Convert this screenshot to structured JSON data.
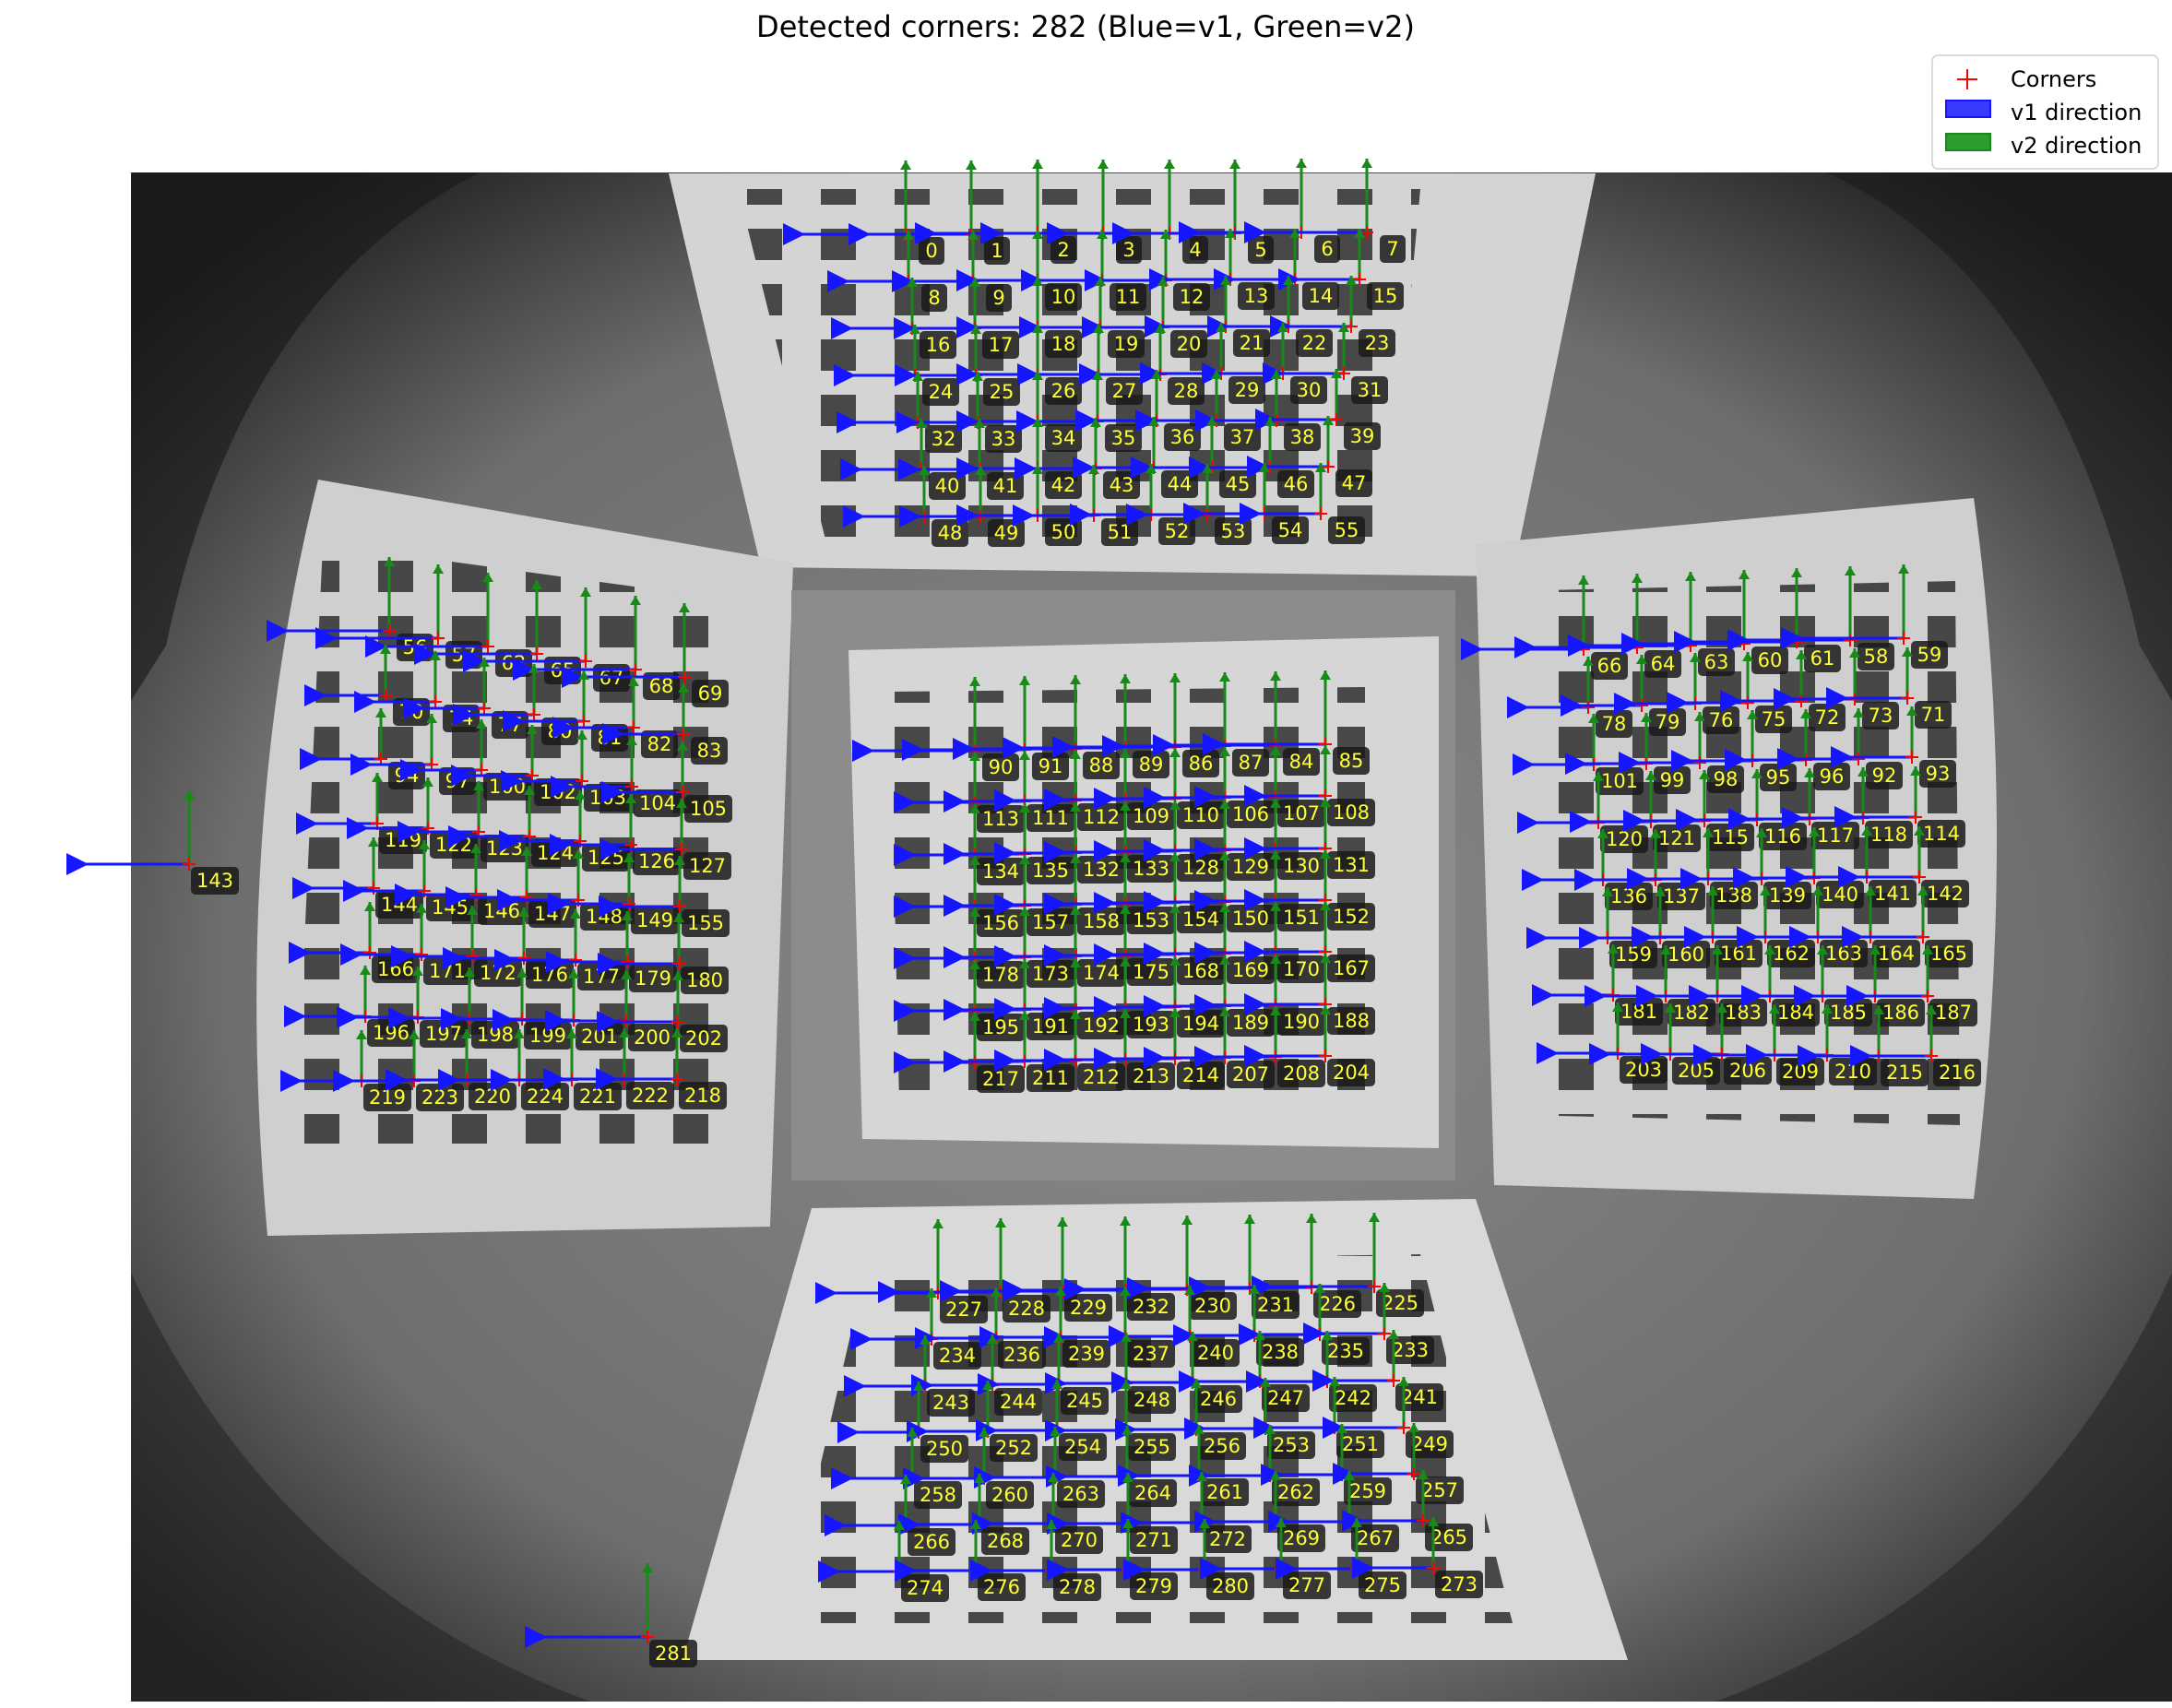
{
  "figure": {
    "title": "Detected corners: 282 (Blue=v1, Green=v2)"
  },
  "legend": {
    "placement": "top-right",
    "items": [
      {
        "label": "Corners",
        "color": "#ff0000",
        "marker": "plus"
      },
      {
        "label": "v1 direction",
        "color": "#1f1fff",
        "marker": "patch"
      },
      {
        "label": "v2 direction",
        "color": "#1a8c1a",
        "marker": "patch"
      }
    ]
  },
  "colors": {
    "v1": "#1515ff",
    "v2": "#178a17",
    "corner": "#ff0000",
    "label_fg": "#ffff33",
    "label_bg": "#1a1a1a"
  },
  "corner_count": 282,
  "boards": [
    {
      "name": "top",
      "ids": [
        [
          0,
          1,
          2,
          3,
          4,
          5,
          6,
          7
        ],
        [
          8,
          9,
          10,
          11,
          12,
          13,
          14,
          15
        ],
        [
          16,
          17,
          18,
          19,
          20,
          21,
          22,
          23
        ],
        [
          24,
          25,
          26,
          27,
          28,
          29,
          30,
          31
        ],
        [
          32,
          33,
          34,
          35,
          36,
          37,
          38,
          39
        ],
        [
          40,
          41,
          42,
          43,
          44,
          45,
          46,
          47
        ],
        [
          48,
          49,
          50,
          51,
          52,
          53,
          54,
          55
        ]
      ]
    },
    {
      "name": "left",
      "ids": [
        [
          56,
          57,
          62,
          65,
          67,
          68,
          69
        ],
        [
          70,
          74,
          77,
          80,
          81,
          82,
          83
        ],
        [
          94,
          97,
          100,
          102,
          103,
          104,
          105
        ],
        [
          119,
          122,
          123,
          124,
          125,
          126,
          127
        ],
        [
          144,
          145,
          146,
          147,
          148,
          149,
          155
        ],
        [
          166,
          171,
          172,
          176,
          177,
          179,
          180
        ],
        [
          196,
          197,
          198,
          199,
          201,
          200,
          202
        ],
        [
          219,
          223,
          220,
          224,
          221,
          222,
          218
        ]
      ]
    },
    {
      "name": "center",
      "ids": [
        [
          90,
          91,
          88,
          89,
          86,
          87,
          84,
          85
        ],
        [
          113,
          111,
          112,
          109,
          110,
          106,
          107,
          108
        ],
        [
          134,
          135,
          132,
          133,
          128,
          129,
          130,
          131
        ],
        [
          156,
          157,
          158,
          153,
          154,
          150,
          151,
          152
        ],
        [
          178,
          173,
          174,
          175,
          168,
          169,
          170,
          167
        ],
        [
          195,
          191,
          192,
          193,
          194,
          189,
          190,
          188
        ],
        [
          217,
          211,
          212,
          213,
          214,
          207,
          208,
          204
        ]
      ]
    },
    {
      "name": "right",
      "ids": [
        [
          66,
          64,
          63,
          60,
          61,
          58,
          59
        ],
        [
          78,
          79,
          76,
          75,
          72,
          73,
          71
        ],
        [
          101,
          99,
          98,
          95,
          96,
          92,
          93
        ],
        [
          120,
          121,
          115,
          116,
          117,
          118,
          114
        ],
        [
          136,
          137,
          138,
          139,
          140,
          141,
          142
        ],
        [
          159,
          160,
          161,
          162,
          163,
          164,
          165
        ],
        [
          181,
          182,
          183,
          184,
          185,
          186,
          187
        ],
        [
          203,
          205,
          206,
          209,
          210,
          215,
          216
        ]
      ]
    },
    {
      "name": "bottom",
      "ids": [
        [
          227,
          228,
          229,
          232,
          230,
          231,
          226,
          225
        ],
        [
          234,
          236,
          239,
          237,
          240,
          238,
          235,
          233
        ],
        [
          243,
          244,
          245,
          248,
          246,
          247,
          242,
          241
        ],
        [
          250,
          252,
          254,
          255,
          256,
          253,
          251,
          249
        ],
        [
          258,
          260,
          263,
          264,
          261,
          262,
          259,
          257
        ],
        [
          266,
          268,
          270,
          271,
          272,
          269,
          267,
          265
        ],
        [
          274,
          276,
          278,
          279,
          280,
          277,
          275,
          273
        ]
      ]
    }
  ],
  "isolated": [
    {
      "id": 143
    },
    {
      "id": 281
    }
  ]
}
